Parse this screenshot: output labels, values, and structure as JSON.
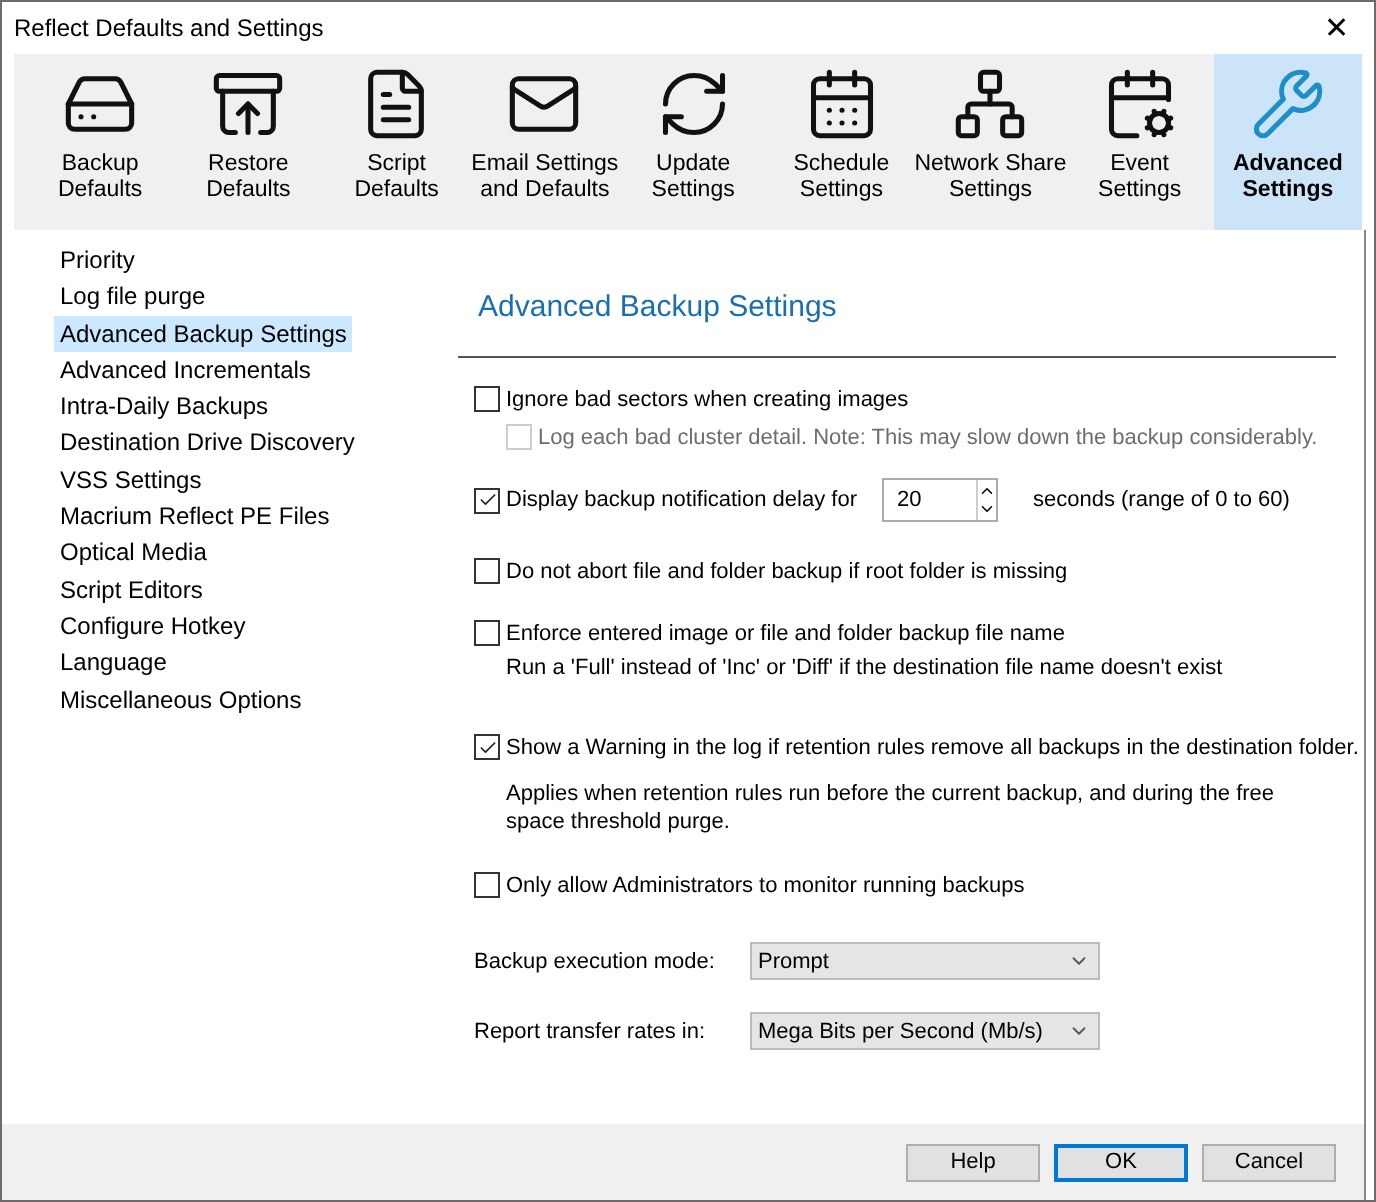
{
  "window": {
    "title": "Reflect Defaults and Settings",
    "close": "✕"
  },
  "toolbar": [
    {
      "kind": "backup",
      "label": "Backup\nDefaults",
      "selected": false
    },
    {
      "kind": "restore",
      "label": "Restore\nDefaults",
      "selected": false
    },
    {
      "kind": "script",
      "label": "Script\nDefaults",
      "selected": false
    },
    {
      "kind": "email",
      "label": "Email Settings\nand Defaults",
      "selected": false
    },
    {
      "kind": "update",
      "label": "Update\nSettings",
      "selected": false
    },
    {
      "kind": "schedule",
      "label": "Schedule\nSettings",
      "selected": false
    },
    {
      "kind": "network",
      "label": "Network Share\nSettings",
      "selected": false
    },
    {
      "kind": "event",
      "label": "Event\nSettings",
      "selected": false
    },
    {
      "kind": "advanced",
      "label": "Advanced\nSettings",
      "selected": true
    }
  ],
  "sidebar": {
    "items": [
      {
        "label": "Priority",
        "selected": false
      },
      {
        "label": "Log file purge",
        "selected": false
      },
      {
        "label": "Advanced Backup Settings",
        "selected": true
      },
      {
        "label": "Advanced Incrementals",
        "selected": false
      },
      {
        "label": "Intra-Daily Backups",
        "selected": false
      },
      {
        "label": "Destination Drive Discovery",
        "selected": false
      },
      {
        "label": "VSS Settings",
        "selected": false
      },
      {
        "label": "Macrium Reflect PE Files",
        "selected": false
      },
      {
        "label": "Optical Media",
        "selected": false
      },
      {
        "label": "Script Editors",
        "selected": false
      },
      {
        "label": "Configure Hotkey",
        "selected": false
      },
      {
        "label": "Language",
        "selected": false
      },
      {
        "label": "Miscellaneous Options",
        "selected": false
      }
    ]
  },
  "panel": {
    "title": "Advanced Backup Settings",
    "options": [
      {
        "kind": "checkbox",
        "label": "Ignore bad sectors when creating images",
        "checked": false,
        "children": [
          {
            "label": "Log each bad cluster detail. Note: This may slow down the backup considerably.",
            "checked": false,
            "disabled": true
          }
        ]
      },
      {
        "kind": "spinner",
        "label": "Display backup notification delay for",
        "checked": true,
        "value": "20",
        "suffix": "seconds (range of 0 to 60)"
      },
      {
        "kind": "checkbox",
        "label": "Do not abort file and folder backup if root folder is missing",
        "checked": false
      },
      {
        "kind": "checkbox",
        "label": "Enforce entered image or file and folder backup file name",
        "checked": false,
        "note": "Run a 'Full' instead of 'Inc' or 'Diff' if the destination file name doesn't exist"
      },
      {
        "kind": "checkbox",
        "label": "Show a Warning in the log if retention rules remove all backups in the destination folder.",
        "checked": true,
        "note": "Applies when retention rules run before the current backup, and during the free space threshold purge."
      },
      {
        "kind": "checkbox",
        "label": "Only allow Administrators to monitor running backups",
        "checked": false
      }
    ],
    "selects": [
      {
        "label": "Backup execution mode:",
        "value": "Prompt"
      },
      {
        "label": "Report transfer rates in:",
        "value": "Mega Bits per Second (Mb/s)"
      }
    ]
  },
  "buttons": [
    {
      "label": "Help",
      "default": false
    },
    {
      "label": "OK",
      "default": true
    },
    {
      "label": "Cancel",
      "default": false
    }
  ]
}
